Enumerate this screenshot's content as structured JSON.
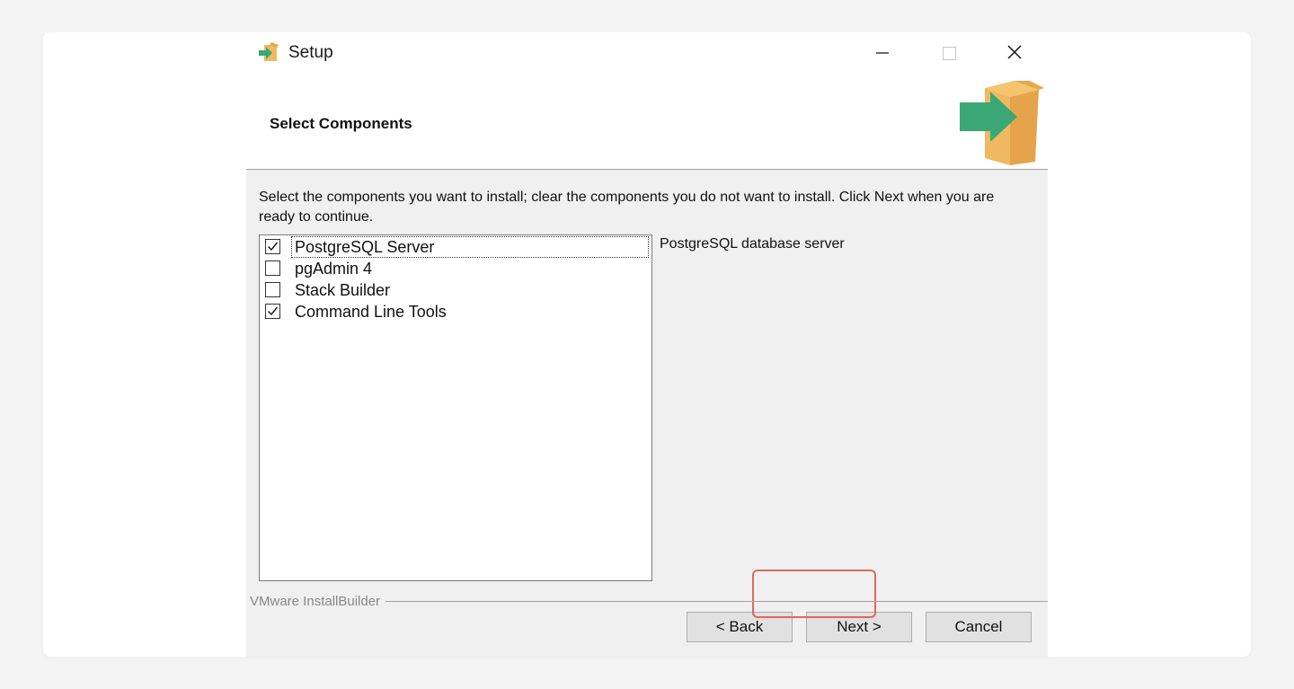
{
  "window": {
    "title": "Setup",
    "controls": [
      "minimize",
      "maximize",
      "close"
    ]
  },
  "header": {
    "title": "Select Components",
    "icon": "box-arrow-icon"
  },
  "instructions": "Select the components you want to install; clear the components you do not want to install. Click Next when you are ready to continue.",
  "components": [
    {
      "label": "PostgreSQL Server",
      "checked": true,
      "focused": true
    },
    {
      "label": "pgAdmin 4",
      "checked": false,
      "focused": false
    },
    {
      "label": "Stack Builder",
      "checked": false,
      "focused": false
    },
    {
      "label": "Command Line Tools",
      "checked": true,
      "focused": false
    }
  ],
  "description": "PostgreSQL database server",
  "footer": {
    "brand": "VMware InstallBuilder",
    "back_label": "< Back",
    "next_label": "Next >",
    "cancel_label": "Cancel"
  },
  "colors": {
    "highlight": "#e0685a",
    "box": "#f0b860",
    "arrow": "#3aa876"
  }
}
